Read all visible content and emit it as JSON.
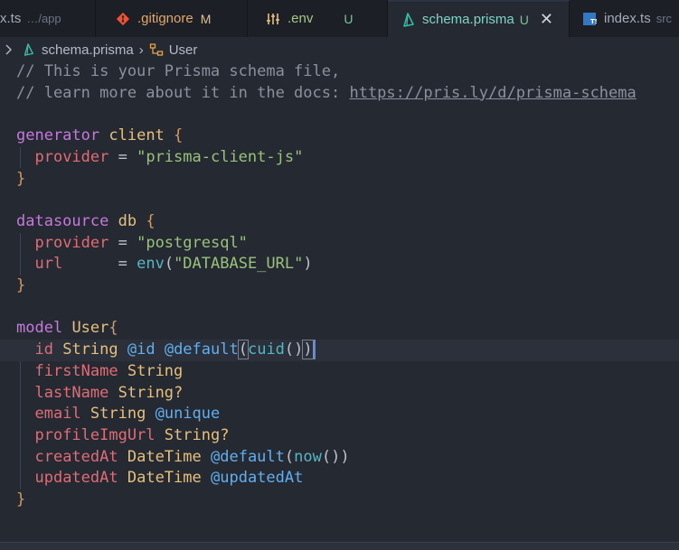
{
  "tabs": [
    {
      "label": "x.ts",
      "sub": "…/app",
      "icon": "typescript-file-icon"
    },
    {
      "label": ".gitignore",
      "status": "M",
      "status_color": "#e2c08d",
      "icon": "git-icon",
      "icon_color": "#f05133"
    },
    {
      "label": ".env",
      "status": "U",
      "status_color": "#73c991",
      "icon": "settings-sliders-icon",
      "icon_color": "#e5c07b"
    },
    {
      "label": "schema.prisma",
      "status": "U",
      "status_color": "#73c991",
      "icon": "prisma-icon",
      "icon_color": "#2fbfa5",
      "active": true,
      "close": "✕"
    },
    {
      "label": "index.ts",
      "sub": "src",
      "icon": "typescript-file-icon",
      "icon_color": "#3178c6"
    }
  ],
  "breadcrumb": {
    "file": "schema.prisma",
    "symbol": "User",
    "sep": "›"
  },
  "code": {
    "comment1": "// This is your Prisma schema file,",
    "comment2_prefix": "// learn more about it in the docs: ",
    "comment2_link": "https://pris.ly/d/prisma-schema",
    "generator_kw": "generator",
    "generator_name": "client",
    "provider_key": "provider",
    "provider_val": "\"prisma-client-js\"",
    "datasource_kw": "datasource",
    "datasource_name": "db",
    "ds_provider_val": "\"postgresql\"",
    "url_key": "url",
    "env_fn": "env",
    "env_arg": "\"DATABASE_URL\"",
    "model_kw": "model",
    "model_name": "User",
    "fields": [
      {
        "name": "id",
        "type": "String",
        "attrs": "@id @default(cuid())"
      },
      {
        "name": "firstName",
        "type": "String"
      },
      {
        "name": "lastName",
        "type": "String?"
      },
      {
        "name": "email",
        "type": "String",
        "attrs": "@unique"
      },
      {
        "name": "profileImgUrl",
        "type": "String?"
      },
      {
        "name": "createdAt",
        "type": "DateTime",
        "attrs": "@default(now())"
      },
      {
        "name": "updatedAt",
        "type": "DateTime",
        "attrs": "@updatedAt"
      }
    ]
  }
}
